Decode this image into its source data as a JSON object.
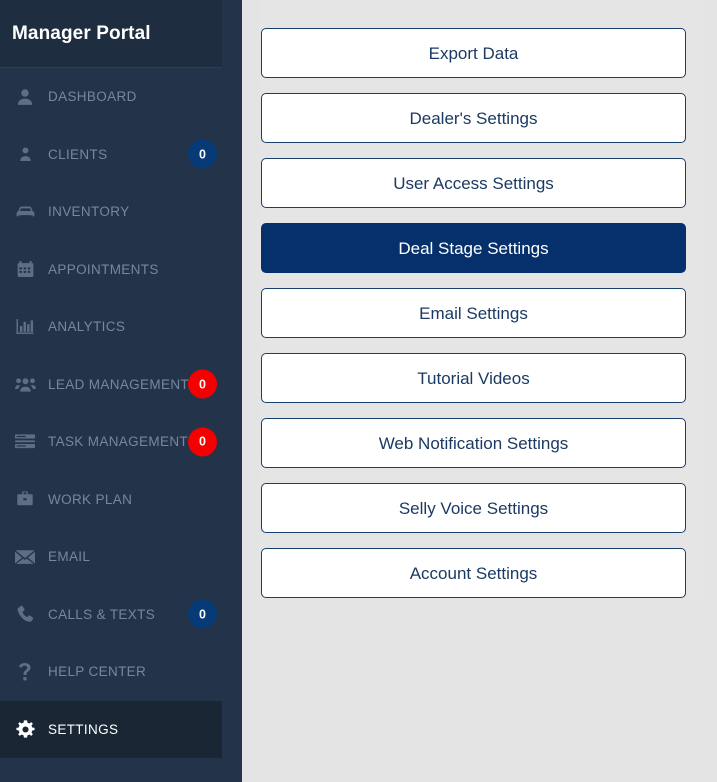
{
  "sidebar": {
    "brand": {
      "title": "Manager Portal"
    },
    "items": [
      {
        "label": "DASHBOARD",
        "icon": "user-silhouette-icon",
        "badge": null,
        "badge_color": null,
        "active": false
      },
      {
        "label": "CLIENTS",
        "icon": "person-icon",
        "badge": "0",
        "badge_color": "#063b78",
        "active": false
      },
      {
        "label": "INVENTORY",
        "icon": "car-icon",
        "badge": null,
        "badge_color": null,
        "active": false
      },
      {
        "label": "APPOINTMENTS",
        "icon": "calendar-icon",
        "badge": null,
        "badge_color": null,
        "active": false
      },
      {
        "label": "ANALYTICS",
        "icon": "bar-chart-icon",
        "badge": null,
        "badge_color": null,
        "active": false
      },
      {
        "label": "LEAD MANAGEMENT",
        "icon": "users-group-icon",
        "badge": "0",
        "badge_color": "#f40000",
        "active": false
      },
      {
        "label": "TASK MANAGEMENT",
        "icon": "task-list-icon",
        "badge": "0",
        "badge_color": "#f40000",
        "active": false
      },
      {
        "label": "WORK PLAN",
        "icon": "briefcase-icon",
        "badge": null,
        "badge_color": null,
        "active": false
      },
      {
        "label": "EMAIL",
        "icon": "envelope-icon",
        "badge": null,
        "badge_color": null,
        "active": false
      },
      {
        "label": "CALLS & TEXTS",
        "icon": "phone-icon",
        "badge": "0",
        "badge_color": "#063b78",
        "active": false
      },
      {
        "label": "HELP CENTER",
        "icon": "question-mark-icon",
        "badge": null,
        "badge_color": null,
        "active": false
      },
      {
        "label": "SETTINGS",
        "icon": "gear-icon",
        "badge": null,
        "badge_color": null,
        "active": true
      }
    ]
  },
  "main": {
    "buttons": [
      {
        "label": "Export Data",
        "selected": false
      },
      {
        "label": "Dealer's Settings",
        "selected": false
      },
      {
        "label": "User Access Settings",
        "selected": false
      },
      {
        "label": "Deal Stage Settings",
        "selected": true
      },
      {
        "label": "Email Settings",
        "selected": false
      },
      {
        "label": "Tutorial Videos",
        "selected": false
      },
      {
        "label": "Web Notification Settings",
        "selected": false
      },
      {
        "label": "Selly Voice Settings",
        "selected": false
      },
      {
        "label": "Account Settings",
        "selected": false
      }
    ]
  },
  "colors": {
    "sidebar_bg": "#233349",
    "sidebar_header_bg": "#1e2d40",
    "sidebar_active_bg": "#1a2634",
    "sidebar_label": "#76889b",
    "page_bg": "#e4e4e4",
    "button_border": "#17406e",
    "button_text": "#1b3a62",
    "button_selected_bg": "#05306b",
    "badge_navy": "#063b78",
    "badge_red": "#f40000"
  }
}
